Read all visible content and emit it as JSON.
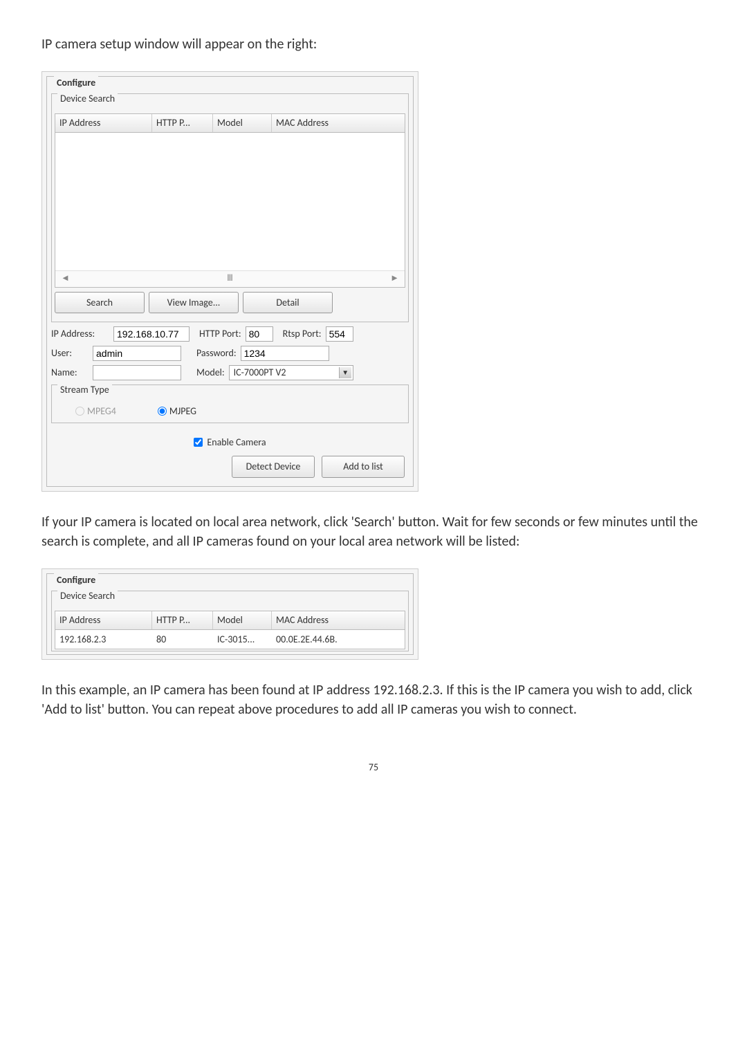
{
  "page_number": "75",
  "intro_text": "IP camera setup window will appear on the right:",
  "para2": "If your IP camera is located on local area network, click 'Search' button. Wait for few seconds or few minutes until the search is complete, and all IP cameras found on your local area network will be listed:",
  "para3": "In this example, an IP camera has been found at IP address 192.168.2.3. If this is the IP camera you wish to add, click 'Add to list' button. You can repeat above procedures to add all IP cameras you wish to connect.",
  "configure": {
    "title": "Configure",
    "device_search_title": "Device Search",
    "columns": {
      "ip": "IP Address",
      "http": "HTTP P...",
      "model": "Model",
      "mac": "MAC Address"
    },
    "buttons": {
      "search": "Search",
      "view_image": "View Image...",
      "detail": "Detail",
      "detect": "Detect Device",
      "add": "Add to list"
    },
    "labels": {
      "ip_address": "IP Address:",
      "http_port": "HTTP Port:",
      "rtsp_port": "Rtsp Port:",
      "user": "User:",
      "password": "Password:",
      "name": "Name:",
      "model": "Model:",
      "stream_type": "Stream Type",
      "mpeg4": "MPEG4",
      "mjpeg": "MJPEG",
      "enable_camera": "Enable Camera"
    },
    "values": {
      "ip_address": "192.168.10.77",
      "http_port": "80",
      "rtsp_port": "554",
      "user": "admin",
      "password": "1234",
      "name": "",
      "model": "IC-7000PT V2"
    },
    "scroll": {
      "left": "◄",
      "mid": "Ⅲ",
      "right": "►"
    }
  },
  "configure2": {
    "title": "Configure",
    "device_search_title": "Device Search",
    "row": {
      "ip": "192.168.2.3",
      "http": "80",
      "model": "IC-3015...",
      "mac": "00.0E.2E.44.6B."
    }
  }
}
